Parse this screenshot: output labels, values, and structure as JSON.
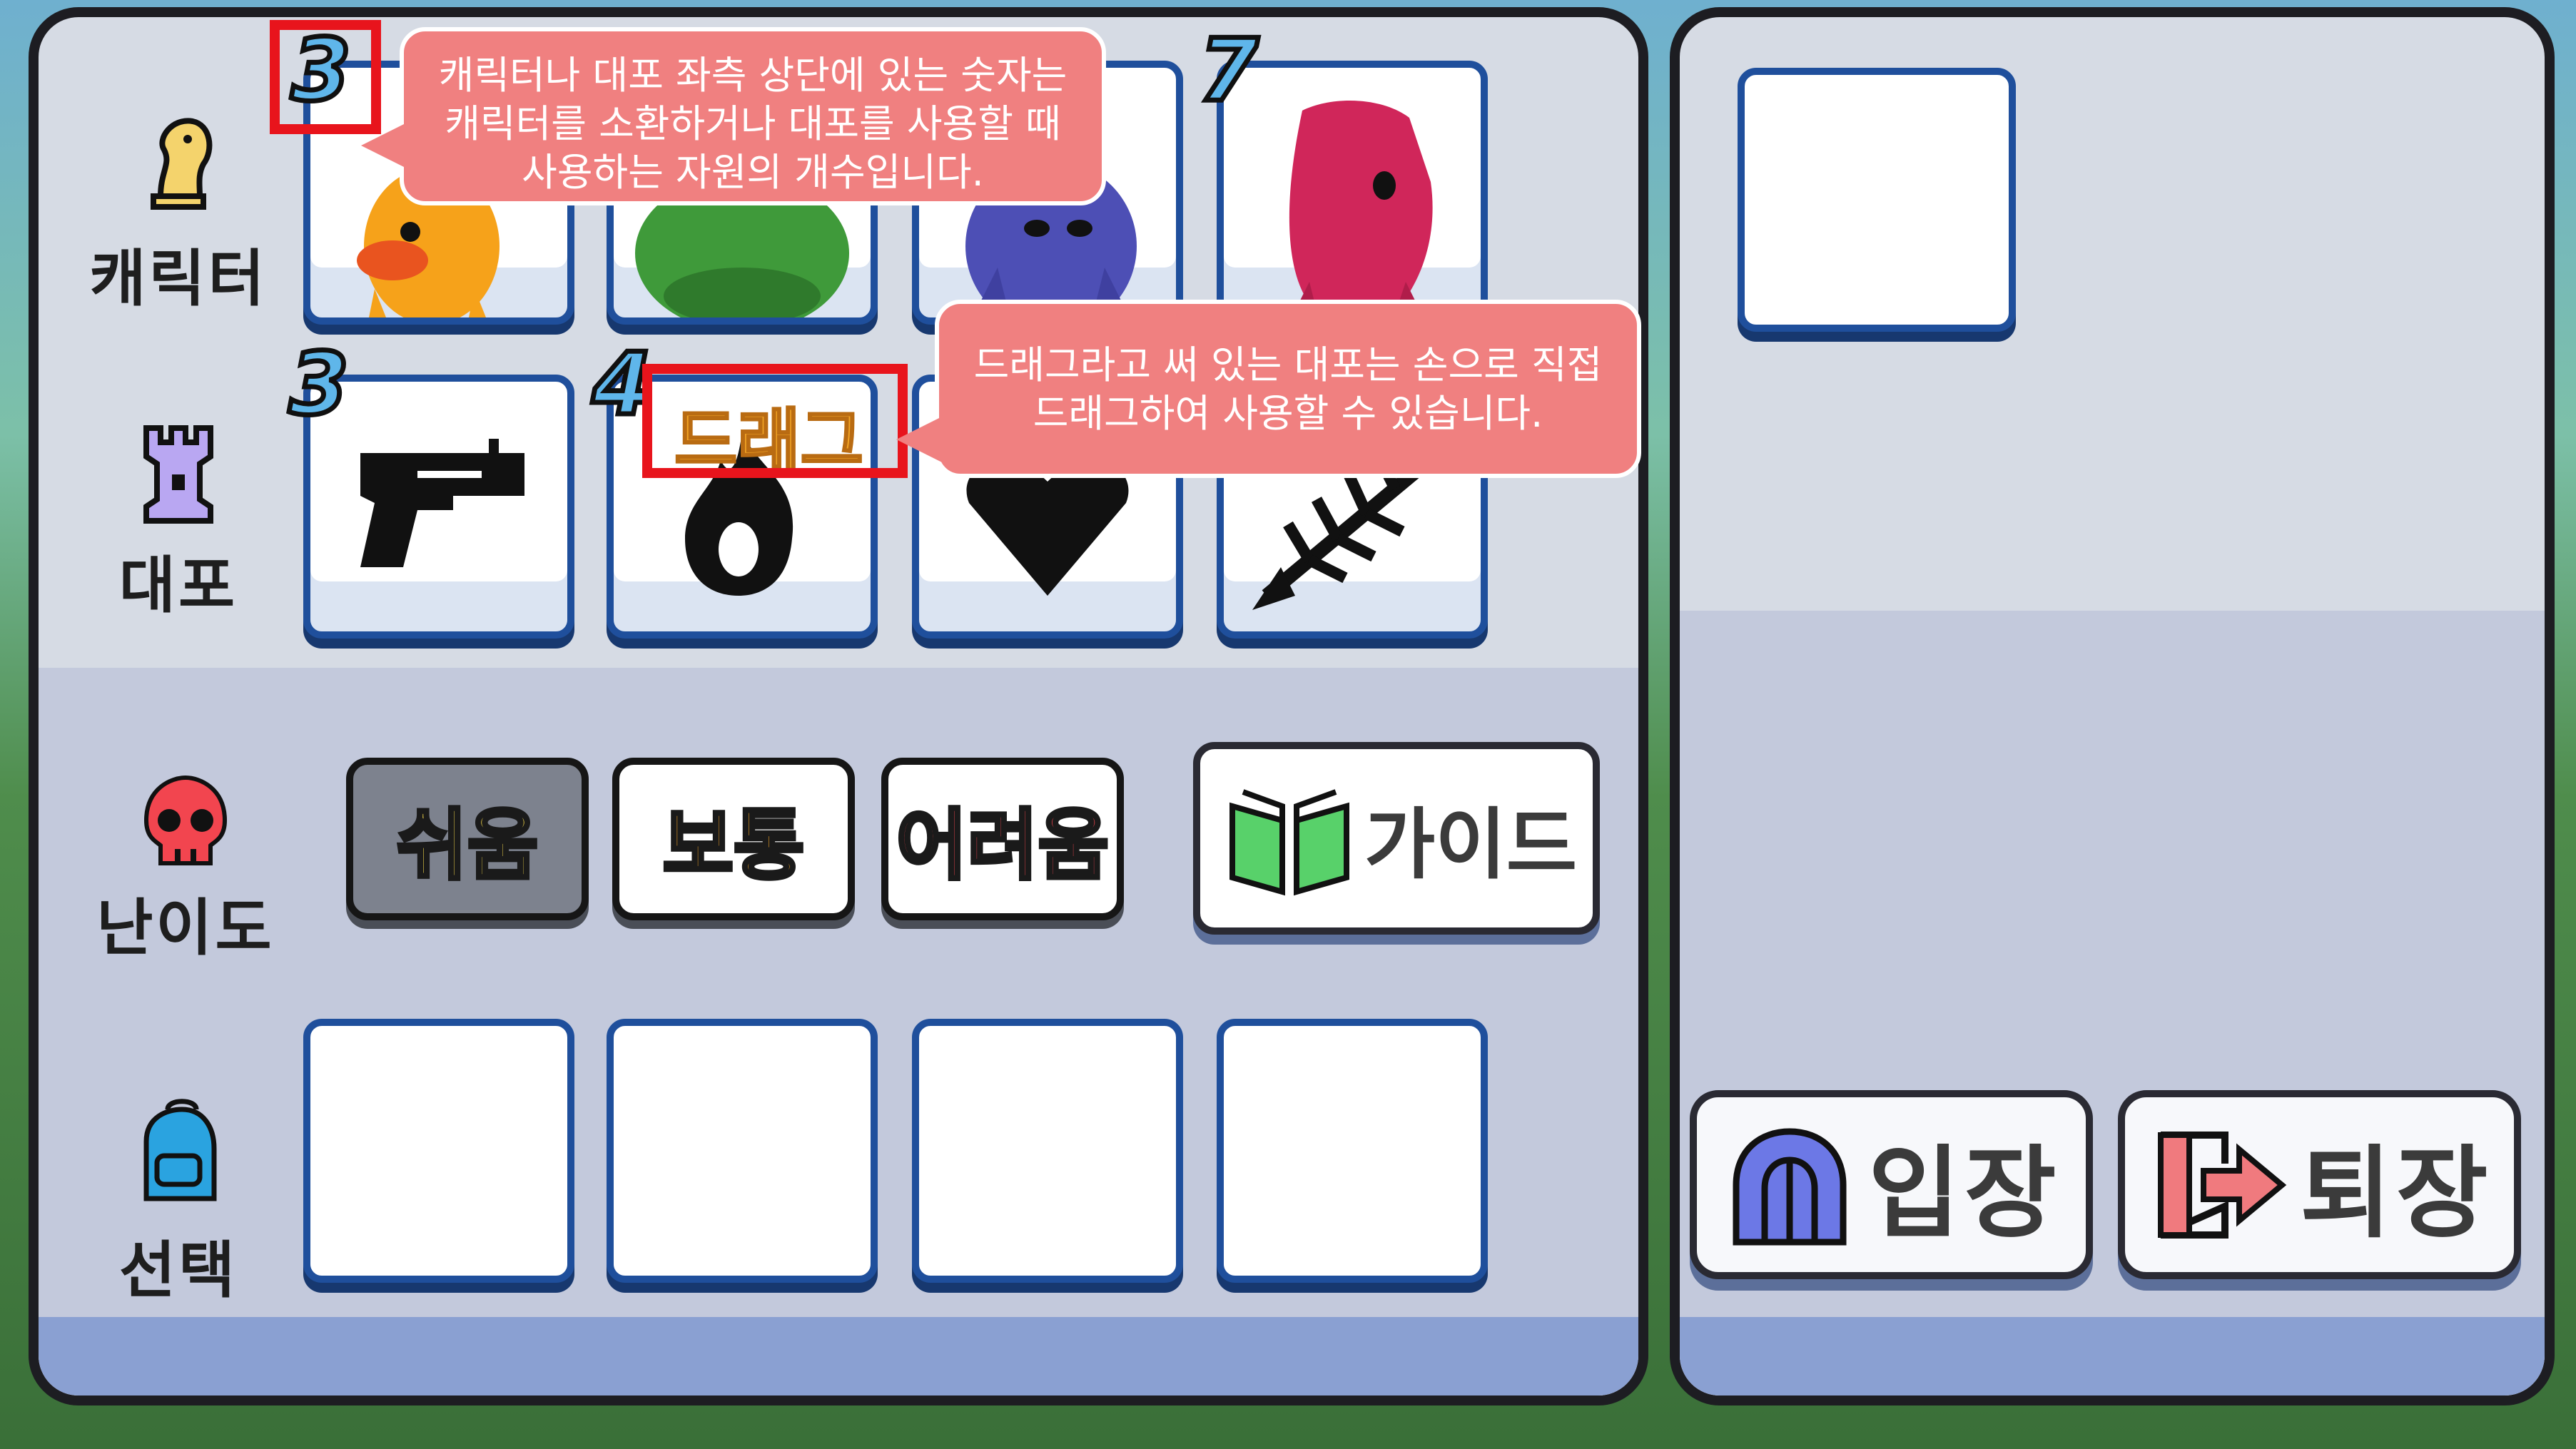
{
  "rows": {
    "character_label": "캐릭터",
    "cannon_label": "대포",
    "difficulty_label": "난이도",
    "select_label": "선택"
  },
  "characters": [
    {
      "cost": "3",
      "name": "yellow-duck-character",
      "color": "#f6a21a"
    },
    {
      "cost": "",
      "name": "green-frog-character",
      "color": "#3f9a3a"
    },
    {
      "cost": "",
      "name": "purple-creature-character",
      "color": "#4d4fb5"
    },
    {
      "cost": "7",
      "name": "red-hooded-character",
      "color": "#d0265a"
    }
  ],
  "cannons": [
    {
      "cost": "3",
      "icon": "revolver-icon"
    },
    {
      "cost": "4",
      "icon": "fire-icon",
      "badge": "드래그"
    },
    {
      "cost": "",
      "icon": "heart-icon"
    },
    {
      "cost": "",
      "icon": "fishbone-icon"
    }
  ],
  "difficulty": {
    "easy": "쉬움",
    "normal": "보통",
    "hard": "어려움",
    "guide": "가이드"
  },
  "actions": {
    "enter": "입장",
    "exit": "퇴장"
  },
  "tooltips": {
    "cost_note": "캐릭터나 대포 좌측 상단에 있는 숫자는 캐릭터를 소환하거나 대포를 사용할 때 사용하는 자원의 개수입니다.",
    "drag_note": "드래그라고 써 있는 대포는 손으로 직접 드래그하여 사용할 수 있습니다."
  },
  "colors": {
    "tooltip_bg": "#f08080",
    "highlight": "#e8141c",
    "slot_border": "#1f4f9c",
    "easy_bg": "#7d828e",
    "easy_text": "#f5d84a",
    "normal_text": "#f3a526",
    "hard_text": "#e0424a"
  }
}
